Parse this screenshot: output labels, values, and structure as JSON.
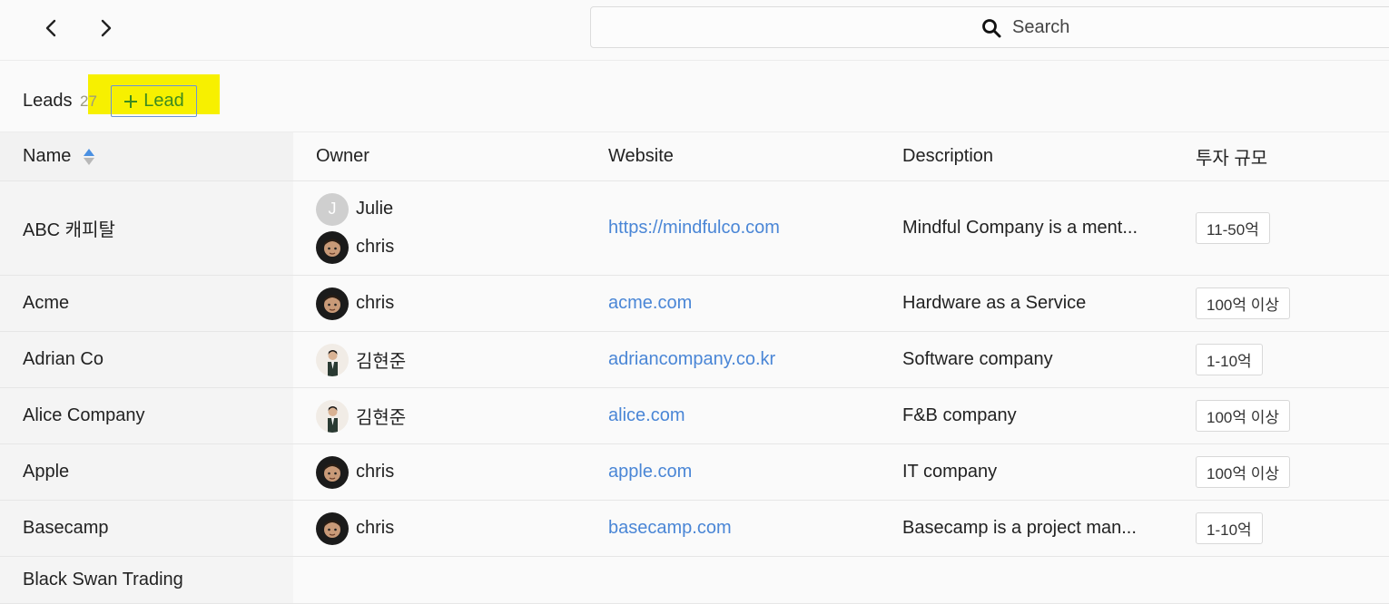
{
  "nav": {
    "back_icon": "chevron-left-icon",
    "forward_icon": "chevron-right-icon"
  },
  "search": {
    "placeholder": "Search",
    "icon": "search-icon"
  },
  "header": {
    "title": "Leads",
    "count": "27",
    "add_label": "Lead",
    "highlight_color": "#f7f000"
  },
  "table": {
    "columns": [
      "Name",
      "Owner",
      "Website",
      "Description",
      "투자 규모"
    ],
    "rows": [
      {
        "name": "ABC 캐피탈",
        "owners": [
          {
            "name": "Julie",
            "initial": "J"
          },
          {
            "name": "chris"
          }
        ],
        "website": "https://mindfulco.com",
        "description": "Mindful Company is a ment...",
        "size": "11-50억"
      },
      {
        "name": "Acme",
        "owners": [
          {
            "name": "chris"
          }
        ],
        "website": "acme.com",
        "description": "Hardware as a Service",
        "size": "100억 이상"
      },
      {
        "name": "Adrian Co",
        "owners": [
          {
            "name": "김현준"
          }
        ],
        "website": "adriancompany.co.kr",
        "description": "Software company",
        "size": "1-10억"
      },
      {
        "name": "Alice Company",
        "owners": [
          {
            "name": "김현준"
          }
        ],
        "website": "alice.com",
        "description": "F&B company",
        "size": "100억 이상"
      },
      {
        "name": "Apple",
        "owners": [
          {
            "name": "chris"
          }
        ],
        "website": "apple.com",
        "description": "IT company",
        "size": "100억 이상"
      },
      {
        "name": "Basecamp",
        "owners": [
          {
            "name": "chris"
          }
        ],
        "website": "basecamp.com",
        "description": "Basecamp is a project man...",
        "size": "1-10억"
      },
      {
        "name": "Black Swan Trading",
        "owners": [],
        "website": "",
        "description": "",
        "size": ""
      }
    ]
  },
  "colors": {
    "link": "#4a86d6",
    "add_button_text": "#3d8b1f",
    "sort_active": "#4a90e2"
  }
}
